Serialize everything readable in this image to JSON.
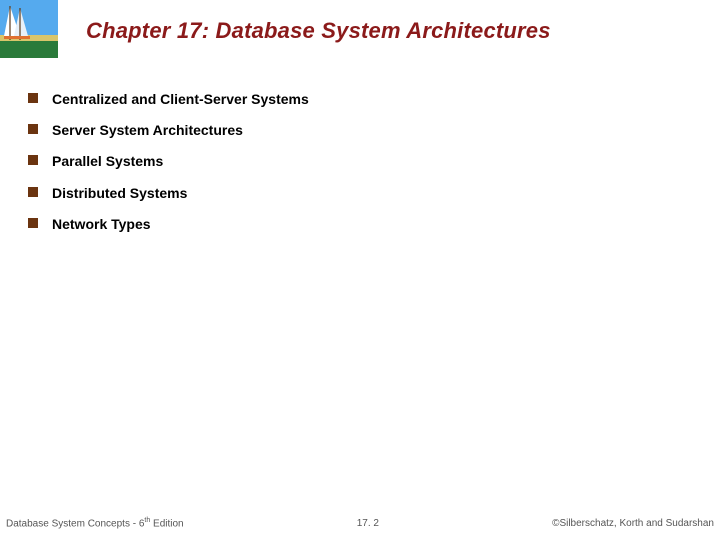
{
  "title": "Chapter 17:  Database System Architectures",
  "bullets": [
    "Centralized and Client-Server Systems",
    "Server System Architectures",
    "Parallel Systems",
    "Distributed Systems",
    "Network Types"
  ],
  "footer": {
    "left_prefix": "Database System Concepts - 6",
    "left_sup": "th",
    "left_suffix": " Edition",
    "center": "17. 2",
    "right": "©Silberschatz, Korth and Sudarshan"
  }
}
